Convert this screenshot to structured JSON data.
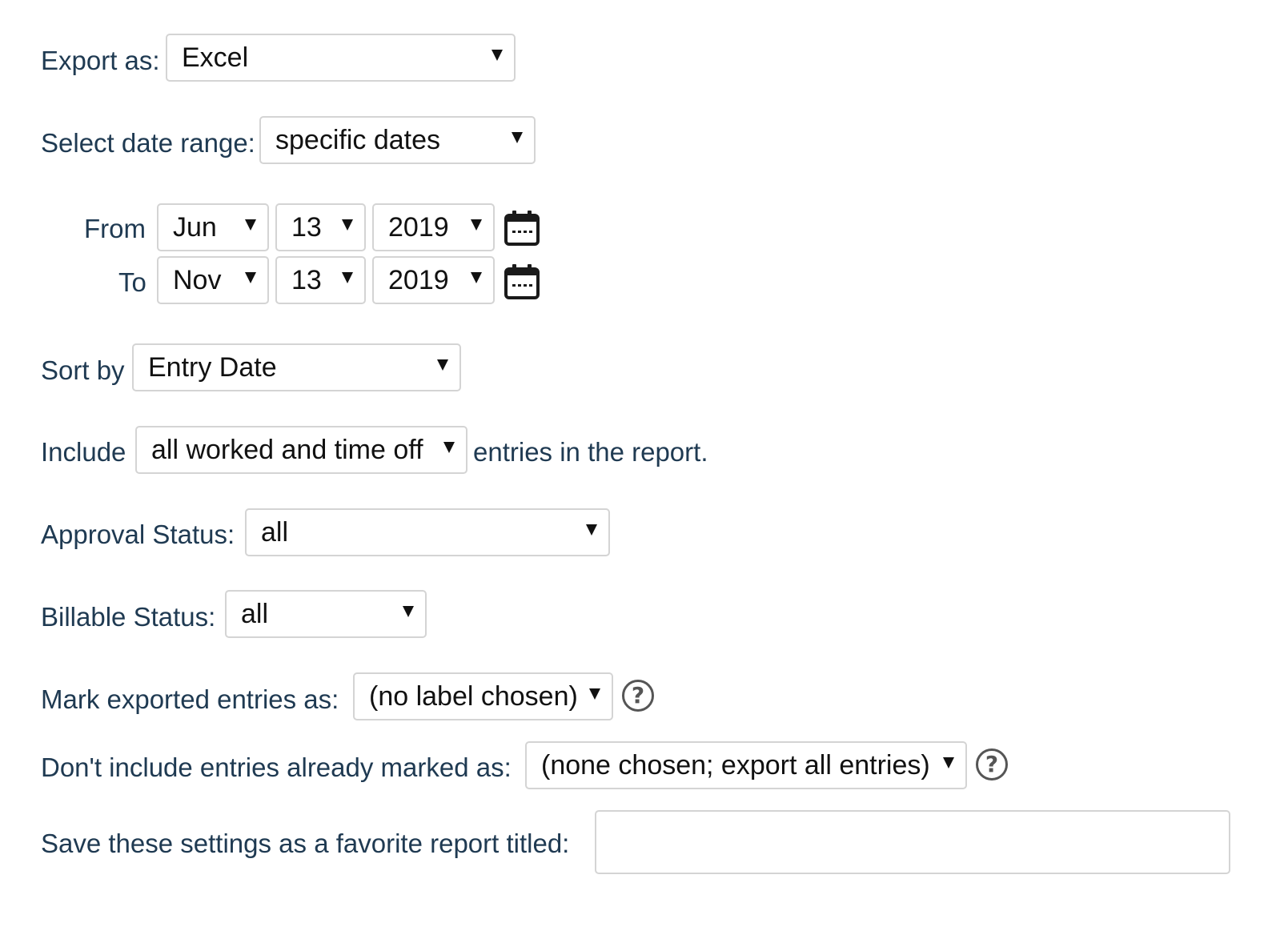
{
  "export": {
    "label": "Export as:",
    "value": "Excel"
  },
  "date_range": {
    "label": "Select date range:",
    "value": "specific dates"
  },
  "from": {
    "label": "From",
    "month": "Jun",
    "day": "13",
    "year": "2019"
  },
  "to": {
    "label": "To",
    "month": "Nov",
    "day": "13",
    "year": "2019"
  },
  "sort": {
    "label": "Sort by",
    "value": "Entry Date"
  },
  "include": {
    "label": "Include",
    "value": "all worked and time off",
    "suffix": "entries in the report."
  },
  "approval": {
    "label": "Approval Status:",
    "value": "all"
  },
  "billable": {
    "label": "Billable Status:",
    "value": "all"
  },
  "mark": {
    "label": "Mark exported entries as:",
    "value": "(no label chosen)",
    "help_glyph": "?"
  },
  "exclude": {
    "label": "Don't include entries already marked as:",
    "value": "(none chosen; export all entries)",
    "help_glyph": "?"
  },
  "favorite": {
    "label": "Save these settings as a favorite report titled:",
    "value": "",
    "placeholder": ""
  },
  "icons": {
    "calendar": "calendar-icon",
    "help": "question-circle-icon",
    "dropdown": "triangle-down-icon"
  }
}
